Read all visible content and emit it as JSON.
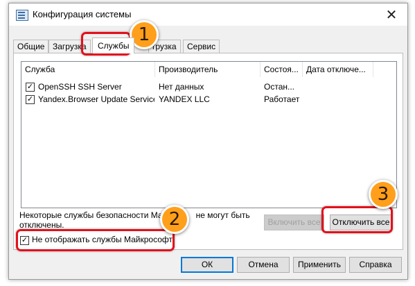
{
  "window": {
    "title": "Конфигурация системы",
    "close_label": "✕"
  },
  "tabs": [
    {
      "label": "Общие"
    },
    {
      "label": "Загрузка"
    },
    {
      "label": "Службы"
    },
    {
      "label": "грузка"
    },
    {
      "label": "Сервис"
    }
  ],
  "services_list": {
    "headers": [
      "Служба",
      "Производитель",
      "Состоя...",
      "Дата отключе..."
    ],
    "rows": [
      {
        "checked": true,
        "name": "OpenSSH SSH Server",
        "vendor": "Нет данных",
        "status": "Остан...",
        "date": ""
      },
      {
        "checked": true,
        "name": "Yandex.Browser Update Service",
        "vendor": "YANDEX LLC",
        "status": "Работает",
        "date": ""
      }
    ]
  },
  "note": {
    "line1_a": "Некоторые службы безопасности Майк",
    "line1_b": "не могут быть",
    "line2": "отключены."
  },
  "buttons": {
    "enable_all": "Включить все",
    "disable_all": "Отключить все",
    "ok": "ОК",
    "cancel": "Отмена",
    "apply": "Применить",
    "help": "Справка"
  },
  "hide_ms": {
    "checked": true,
    "label": "Не отображать службы Майкрософт"
  },
  "badges": [
    "1",
    "2",
    "3"
  ],
  "colors": {
    "highlight": "#e3101b",
    "badge": "#ff9f1c",
    "accent": "#0078d7"
  }
}
